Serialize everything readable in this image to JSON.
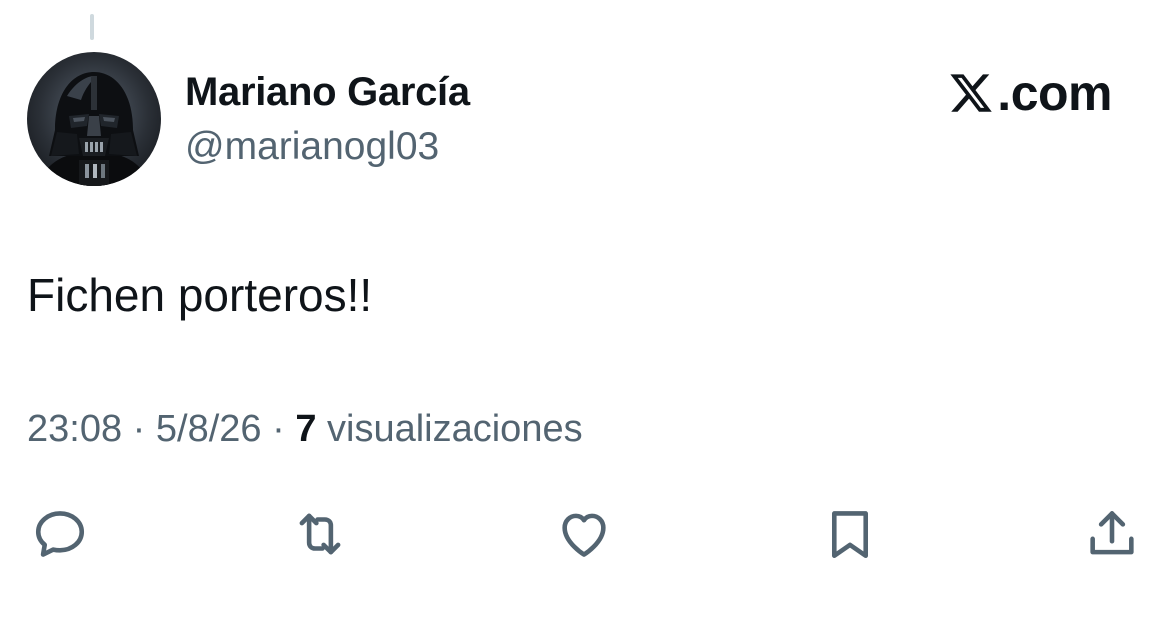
{
  "tweet": {
    "author": {
      "name": "Mariano García",
      "handle": "@marianogl03",
      "avatar_icon": "darth-vader-avatar"
    },
    "brand": {
      "logo_icon": "x-logo-icon",
      "suffix": ".com"
    },
    "text": "Fichen porteros!!",
    "meta": {
      "time": "23:08",
      "separator": "·",
      "date": "5/8/26",
      "views_count": "7",
      "views_label": "visualizaciones"
    },
    "actions": [
      {
        "name": "reply",
        "icon": "comment-icon"
      },
      {
        "name": "repost",
        "icon": "repost-icon"
      },
      {
        "name": "like",
        "icon": "heart-icon"
      },
      {
        "name": "bookmark",
        "icon": "bookmark-icon"
      },
      {
        "name": "share",
        "icon": "share-icon"
      }
    ],
    "colors": {
      "text_primary": "#0f1419",
      "text_secondary": "#536471",
      "thread_line": "#cfd9de"
    }
  }
}
